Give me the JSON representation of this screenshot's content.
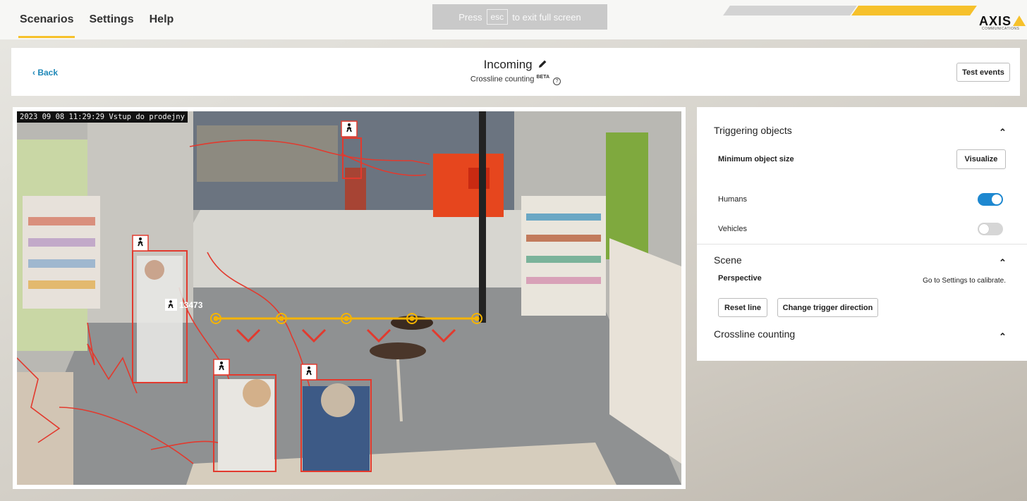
{
  "nav": {
    "tabs": [
      {
        "label": "Scenarios",
        "active": true
      },
      {
        "label": "Settings",
        "active": false
      },
      {
        "label": "Help",
        "active": false
      }
    ]
  },
  "fullscreen_banner": {
    "pre": "Press",
    "key": "esc",
    "post": "to exit full screen"
  },
  "brand": {
    "logo": "AXIS",
    "sub": "COMMUNICATIONS",
    "accent": "#f6c12b"
  },
  "header": {
    "back_label": "‹ Back",
    "title": "Incoming",
    "edit_icon": "pencil-icon",
    "subtitle": "Crossline counting",
    "badge": "BETA",
    "help_icon": "question-circle-icon",
    "help_glyph": "?",
    "test_events_label": "Test events"
  },
  "video": {
    "timestamp": "2023 09 08 11:29:29 Vstup do prodejny",
    "object_id": "13473",
    "line_color": "#f5b400",
    "box_color": "#e23a2e"
  },
  "panel": {
    "triggering": {
      "title": "Triggering objects",
      "min_size_label": "Minimum object size",
      "visualize_label": "Visualize",
      "humans_label": "Humans",
      "humans_on": true,
      "vehicles_label": "Vehicles",
      "vehicles_on": false
    },
    "scene": {
      "title": "Scene",
      "perspective_label": "Perspective",
      "calibrate_text": "Go to Settings to calibrate.",
      "reset_label": "Reset line",
      "change_dir_label": "Change trigger direction"
    },
    "crossline": {
      "title": "Crossline counting"
    },
    "chevron_glyph": "⌃",
    "toggle_on_color": "#1e88d0"
  }
}
